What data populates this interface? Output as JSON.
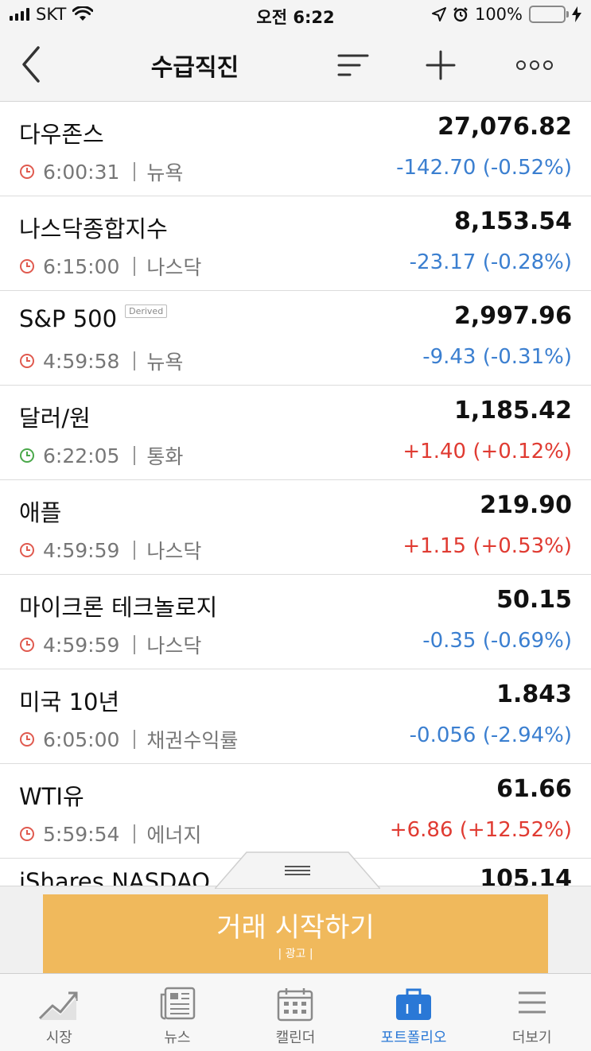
{
  "status": {
    "carrier": "SKT",
    "time": "오전 6:22",
    "battery": "100%",
    "battery_level": 1.0
  },
  "nav": {
    "title": "수급직진"
  },
  "colors": {
    "down": "#3b7fd0",
    "up": "#e03b32",
    "accent": "#2a78d6",
    "ad": "#f0b95c",
    "clock_active": "#4aa84a",
    "clock_closed": "#e05a4f"
  },
  "rows": [
    {
      "name": "다우존스",
      "badge": "",
      "price": "27,076.82",
      "time": "6:00:31",
      "market": "뉴욕",
      "change": "-142.70 (-0.52%)",
      "dir": "down",
      "clock": "closed"
    },
    {
      "name": "나스닥종합지수",
      "badge": "",
      "price": "8,153.54",
      "time": "6:15:00",
      "market": "나스닥",
      "change": "-23.17 (-0.28%)",
      "dir": "down",
      "clock": "closed"
    },
    {
      "name": "S&P 500",
      "badge": "Derived",
      "price": "2,997.96",
      "time": "4:59:58",
      "market": "뉴욕",
      "change": "-9.43 (-0.31%)",
      "dir": "down",
      "clock": "closed"
    },
    {
      "name": "달러/원",
      "badge": "",
      "price": "1,185.42",
      "time": "6:22:05",
      "market": "통화",
      "change": "+1.40 (+0.12%)",
      "dir": "up",
      "clock": "active"
    },
    {
      "name": "애플",
      "badge": "",
      "price": "219.90",
      "time": "4:59:59",
      "market": "나스닥",
      "change": "+1.15 (+0.53%)",
      "dir": "up",
      "clock": "closed"
    },
    {
      "name": "마이크론 테크놀로지",
      "badge": "",
      "price": "50.15",
      "time": "4:59:59",
      "market": "나스닥",
      "change": "-0.35 (-0.69%)",
      "dir": "down",
      "clock": "closed"
    },
    {
      "name": "미국 10년",
      "badge": "",
      "price": "1.843",
      "time": "6:05:00",
      "market": "채권수익률",
      "change": "-0.056 (-2.94%)",
      "dir": "down",
      "clock": "closed"
    },
    {
      "name": "WTI유",
      "badge": "",
      "price": "61.66",
      "time": "5:59:54",
      "market": "에너지",
      "change": "+6.86 (+12.52%)",
      "dir": "up",
      "clock": "closed"
    }
  ],
  "peek_row": {
    "name": "iShares NASDAQ",
    "price": "105.14"
  },
  "ad": {
    "title": "거래 시작하기",
    "label": "| 광고 |"
  },
  "tabs": [
    {
      "label": "시장",
      "icon": "chart-trend-icon"
    },
    {
      "label": "뉴스",
      "icon": "newspaper-icon"
    },
    {
      "label": "캘린더",
      "icon": "calendar-icon"
    },
    {
      "label": "포트폴리오",
      "icon": "briefcase-icon"
    },
    {
      "label": "더보기",
      "icon": "hamburger-menu-icon"
    }
  ],
  "active_tab": 3
}
